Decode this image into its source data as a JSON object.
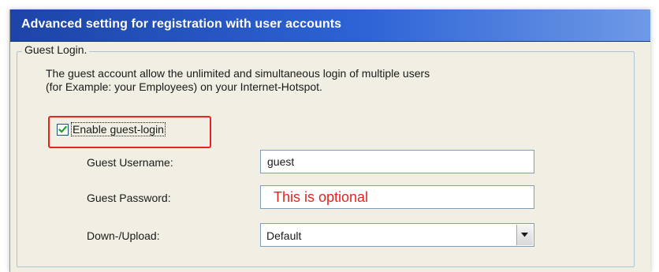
{
  "dialog": {
    "title": "Advanced setting for registration with user accounts"
  },
  "group": {
    "legend": "Guest Login.",
    "description_line1": "The guest account allow the unlimited and simultaneous login of multiple users",
    "description_line2": "(for Example: your Employees)  on your Internet-Hotspot."
  },
  "guest_login": {
    "enable_label": "Enable guest-login",
    "enabled": true
  },
  "fields": {
    "username_label": "Guest Username:",
    "username_value": "guest",
    "password_label": "Guest Password:",
    "password_placeholder": "This is optional",
    "bandwidth_label": "Down-/Upload:",
    "bandwidth_selected": "Default"
  },
  "colors": {
    "title_bar": "#2d63d6",
    "highlight": "#e52420",
    "checkmark": "#21a121"
  },
  "icons": {
    "check": "checkmark-icon",
    "dropdown": "chevron-down-icon"
  }
}
